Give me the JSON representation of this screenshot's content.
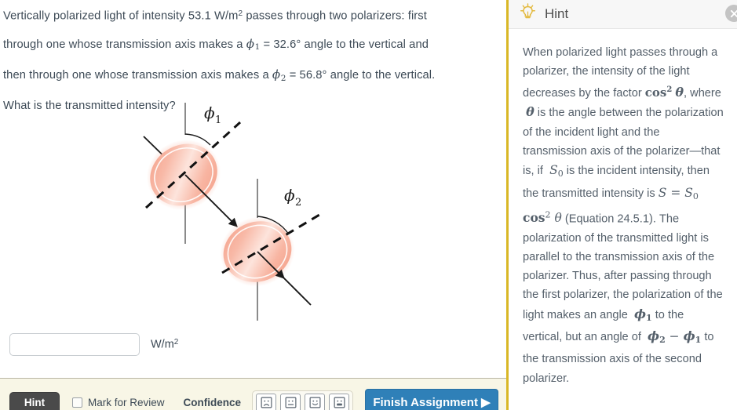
{
  "question": {
    "line1_a": "Vertically polarized light of intensity ",
    "intensity_value": "53.1",
    "intensity_unit_base": " W/m",
    "intensity_unit_exp": "2",
    "line1_b": " passes through two polarizers: first",
    "line2_a": "through one whose transmission axis makes a ",
    "phi1_symbol": "ϕ",
    "phi1_sub": "1",
    "line2_b": " = 32.6° angle to the vertical and",
    "line3_a": "then through one whose transmission axis makes a ",
    "phi2_symbol": "ϕ",
    "phi2_sub": "2",
    "line3_b": " = 56.8° angle to the vertical.",
    "line4": "What is the transmitted intensity?"
  },
  "diagram": {
    "name": "two-polarizers-diagram",
    "phi1_label": "ϕ",
    "phi1_sub": "1",
    "phi2_label": "ϕ",
    "phi2_sub": "2",
    "disk_color_light": "#fde2d9",
    "disk_color_mid": "#f7b4a0",
    "disk_color_edge": "#f19a84",
    "line_color": "#1a1a1a",
    "axis_color": "#7a7a7a"
  },
  "answer": {
    "value": "",
    "placeholder": "",
    "unit_base": "W/m",
    "unit_exp": "2"
  },
  "toolbar": {
    "hint_label": "Hint",
    "mark_for_review_label": "Mark for Review",
    "mark_for_review_checked": false,
    "confidence_label": "Confidence",
    "confidence_faces": [
      "frown-face-icon",
      "neutral-face-icon",
      "smile-face-icon",
      "grin-face-icon"
    ],
    "finish_label": "Finish Assignment ▶",
    "finish_color": "#2f80b8",
    "bar_color": "#f8f6e6"
  },
  "hint": {
    "title": "Hint",
    "icon": "lightbulb-icon",
    "close_icon": "close-icon",
    "accent_color": "#d9b726",
    "p1_a": "When polarized light passes through a polarizer, the intensity of the light decreases by the factor ",
    "cos_text": "cos",
    "cos_exp": "2",
    "theta": "θ",
    "p1_b": ", where ",
    "p1_c": " is the angle between the polarization of the incident light and the transmission axis of the polarizer—that is, if ",
    "S0_S": "S",
    "S0_sub": "0",
    "p1_d": " is the incident intensity, then the transmitted intensity is ",
    "equation": "S = S₀ cos² θ",
    "eq_ref": " (Equation 24.5.1). ",
    "p1_e": "The polarization of the transmitted light is parallel to the transmission axis of the polarizer. Thus, after passing through the first polarizer, the polarization of the light makes an angle ",
    "phi1": "ϕ",
    "phi1_sub": "1",
    "p1_f": " to the vertical, but an angle of ",
    "phi2": "ϕ",
    "phi2_sub": "2",
    "minus": " − ",
    "p1_g": " to the transmission axis of the second polarizer."
  }
}
